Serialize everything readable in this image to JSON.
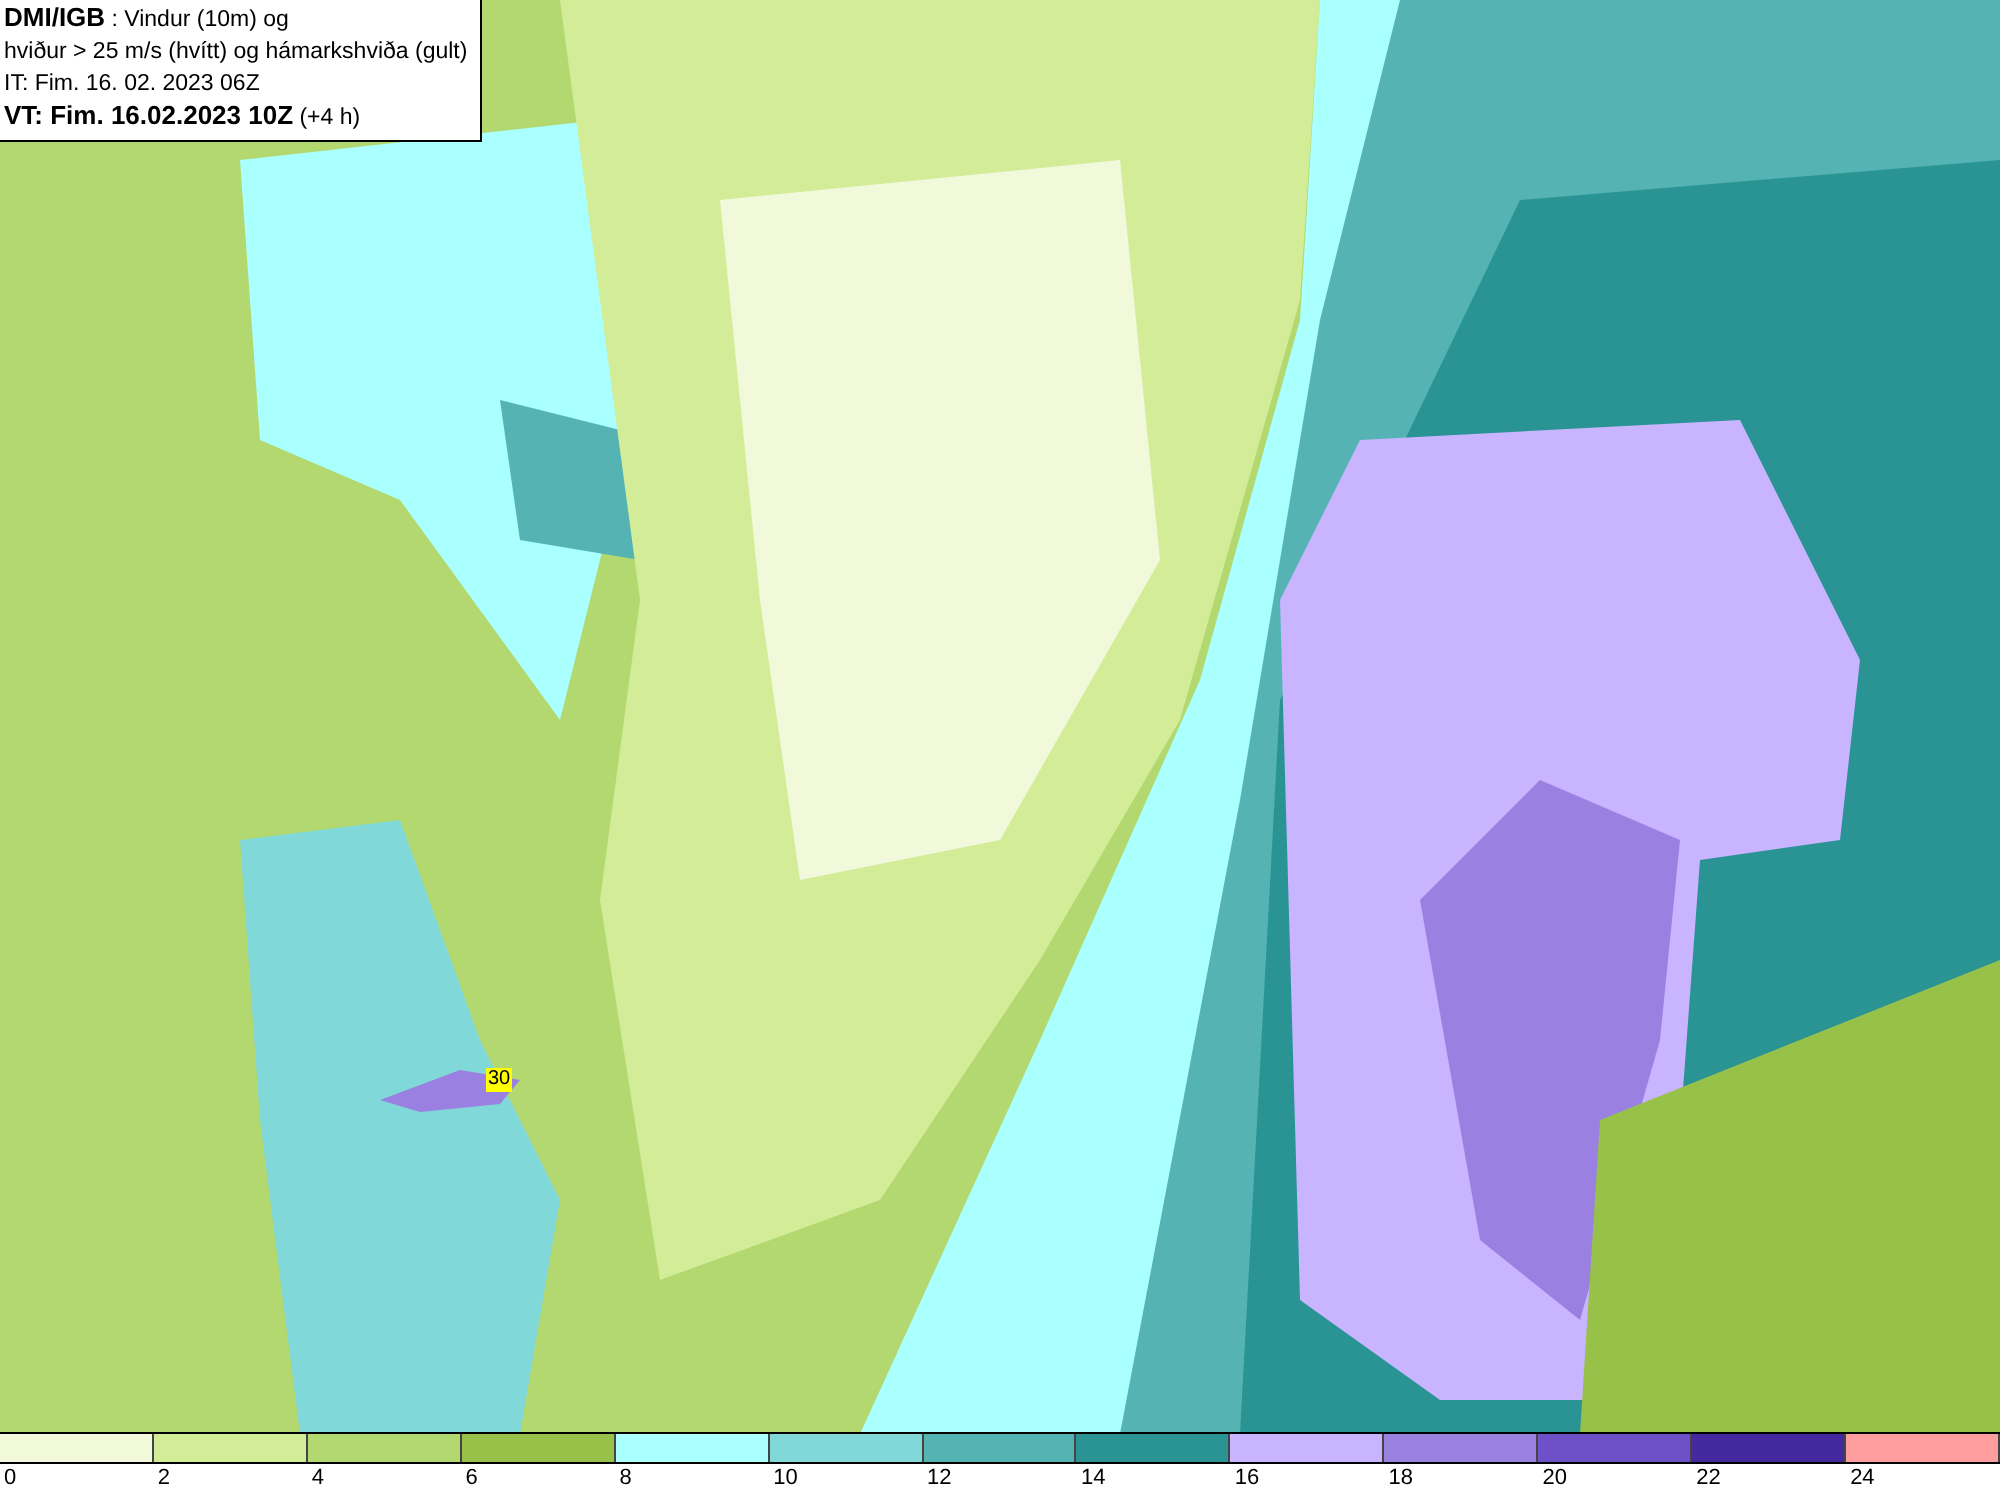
{
  "title_box": {
    "lines": [
      "**DMI/IGB** : Vindur (10m) og",
      "hviður > 25 m/s (hvítt) og hámarkshviða (gult)",
      "IT: Fim. 16. 02. 2023 06Z",
      "**VT: Fim. 16.02.2023 10Z** (+4 h)"
    ]
  },
  "map": {
    "gust_label": "30"
  },
  "legend": {
    "bins": [
      {
        "color": "#f2f9da",
        "tick": "0"
      },
      {
        "color": "#d3ec98",
        "tick": "2"
      },
      {
        "color": "#b2d86f",
        "tick": "4"
      },
      {
        "color": "#98c14a",
        "tick": "6"
      },
      {
        "color": "#aaffff",
        "tick": "8"
      },
      {
        "color": "#80d8d8",
        "tick": "10"
      },
      {
        "color": "#55b3b3",
        "tick": "12"
      },
      {
        "color": "#2a9494",
        "tick": "14"
      },
      {
        "color": "#c8b4ff",
        "tick": "16"
      },
      {
        "color": "#9a80e0",
        "tick": "18"
      },
      {
        "color": "#6e50c8",
        "tick": "20"
      },
      {
        "color": "#43289e",
        "tick": "22"
      },
      {
        "color": "#ff9e9e",
        "tick": "24"
      }
    ]
  }
}
